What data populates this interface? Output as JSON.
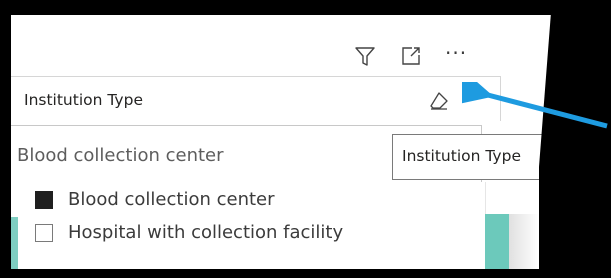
{
  "toolbar": {
    "filter_icon": "filter-icon",
    "focus_icon": "focus-mode-icon",
    "more_label": "···"
  },
  "slicer": {
    "title": "Institution Type",
    "clear_icon": "eraser-icon",
    "selected_value": "Blood collection center",
    "tooltip": "Institution Type",
    "options": [
      {
        "label": "Blood collection center",
        "checked": true
      },
      {
        "label": "Hospital with collection facility",
        "checked": false
      }
    ]
  },
  "annotation": {
    "arrow_color": "#1e9be0"
  },
  "colors": {
    "accent_teal": "#6cc9bb"
  }
}
